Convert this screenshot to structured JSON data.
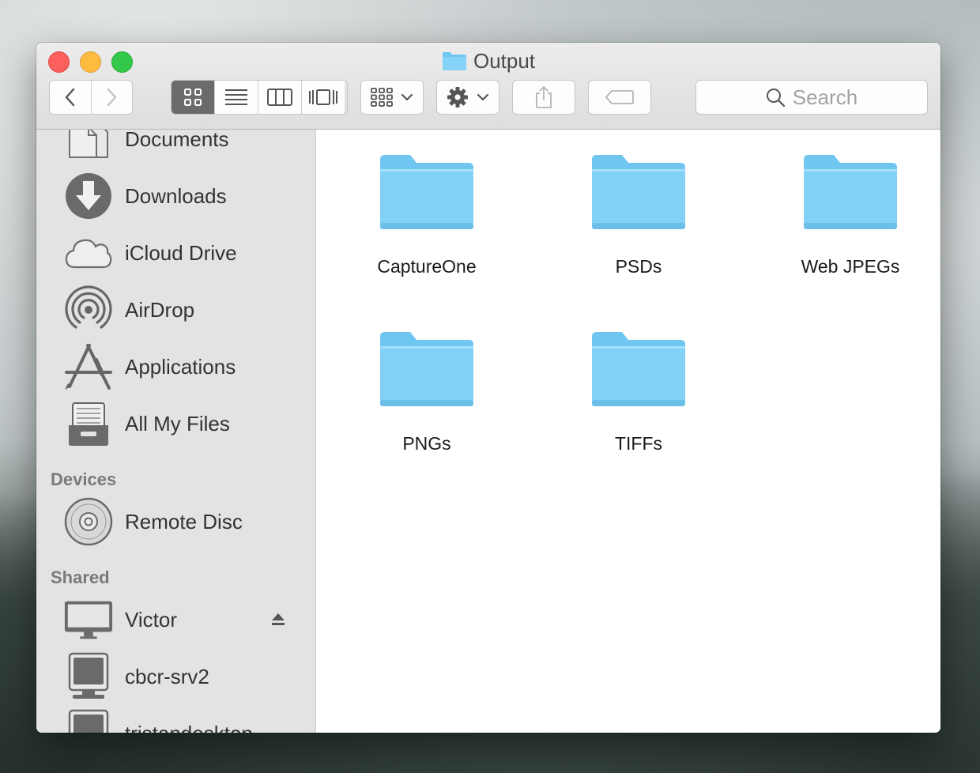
{
  "window": {
    "title": "Output"
  },
  "toolbar": {
    "back_icon": "chevron-left-icon",
    "forward_icon": "chevron-right-icon",
    "view_modes": [
      "icon-view",
      "list-view",
      "column-view",
      "cover-flow-view"
    ],
    "active_view": "icon-view",
    "arrange_icon": "arrange-grid-icon",
    "action_icon": "gear-icon",
    "share_icon": "share-icon",
    "tag_icon": "tag-icon",
    "search_placeholder": "Search"
  },
  "sidebar": {
    "favorites": [
      {
        "label": "Documents",
        "icon": "documents-icon"
      },
      {
        "label": "Downloads",
        "icon": "downloads-icon"
      },
      {
        "label": "iCloud Drive",
        "icon": "icloud-icon"
      },
      {
        "label": "AirDrop",
        "icon": "airdrop-icon"
      },
      {
        "label": "Applications",
        "icon": "applications-icon"
      },
      {
        "label": "All My Files",
        "icon": "all-my-files-icon"
      }
    ],
    "devices_heading": "Devices",
    "devices": [
      {
        "label": "Remote Disc",
        "icon": "disc-icon"
      }
    ],
    "shared_heading": "Shared",
    "shared": [
      {
        "label": "Victor",
        "icon": "display-icon",
        "ejectable": true
      },
      {
        "label": "cbcr-srv2",
        "icon": "computer-icon"
      },
      {
        "label": "tristandesktop",
        "icon": "computer-icon"
      }
    ]
  },
  "content": {
    "folders": [
      {
        "name": "CaptureOne"
      },
      {
        "name": "PSDs"
      },
      {
        "name": "Web JPEGs"
      },
      {
        "name": "PNGs"
      },
      {
        "name": "TIFFs"
      }
    ]
  },
  "colors": {
    "folder_fill": "#7fd0f6",
    "folder_tab": "#9adcf9",
    "close": "#fc605c",
    "minimize": "#fdbc40",
    "maximize": "#34c84a"
  }
}
